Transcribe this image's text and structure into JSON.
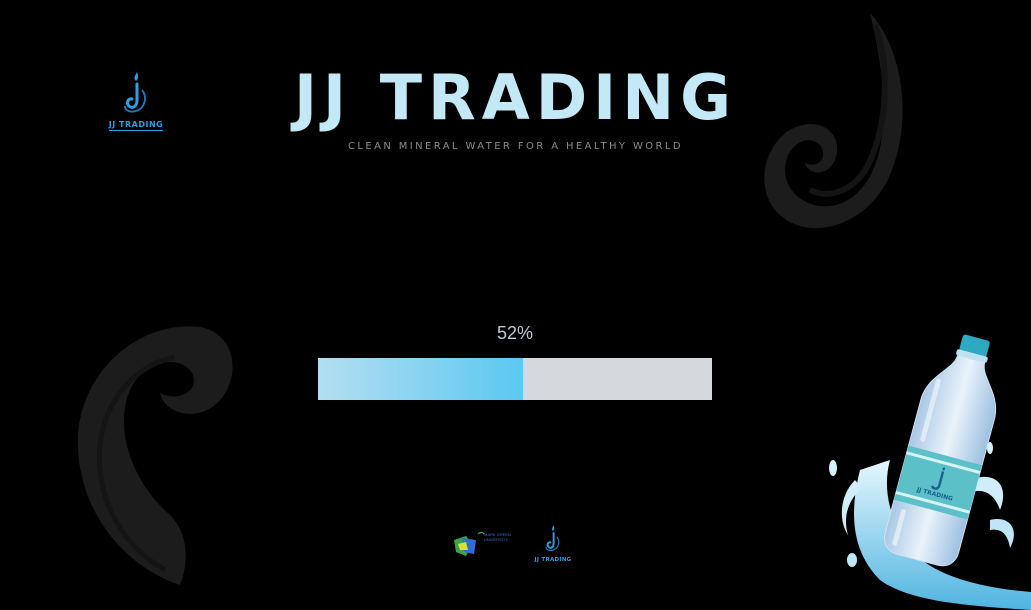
{
  "header": {
    "title": "JJ TRADING",
    "tagline": "CLEAN MINERAL WATER FOR A HEALTHY WORLD",
    "logo_text": "JJ TRADING",
    "logo_icon": "water-drop-j-icon"
  },
  "loader": {
    "percent_label": "52%",
    "progress": 0.52
  },
  "footer": {
    "partner_logo_text": "MARK GREEN UNIVERSITY",
    "jj_logo_text": "JJ TRADING"
  },
  "decor": {
    "bottle_label": "JJ TRADING",
    "swirl_icon": "water-swirl-icon",
    "bottle_icon": "water-bottle-icon"
  },
  "colors": {
    "background": "#000000",
    "title": "#c3e8f6",
    "accent": "#2f9fe0",
    "progress_fill_start": "#b4def0",
    "progress_fill_end": "#5bc8f0",
    "progress_track": "#d4d9dd"
  }
}
